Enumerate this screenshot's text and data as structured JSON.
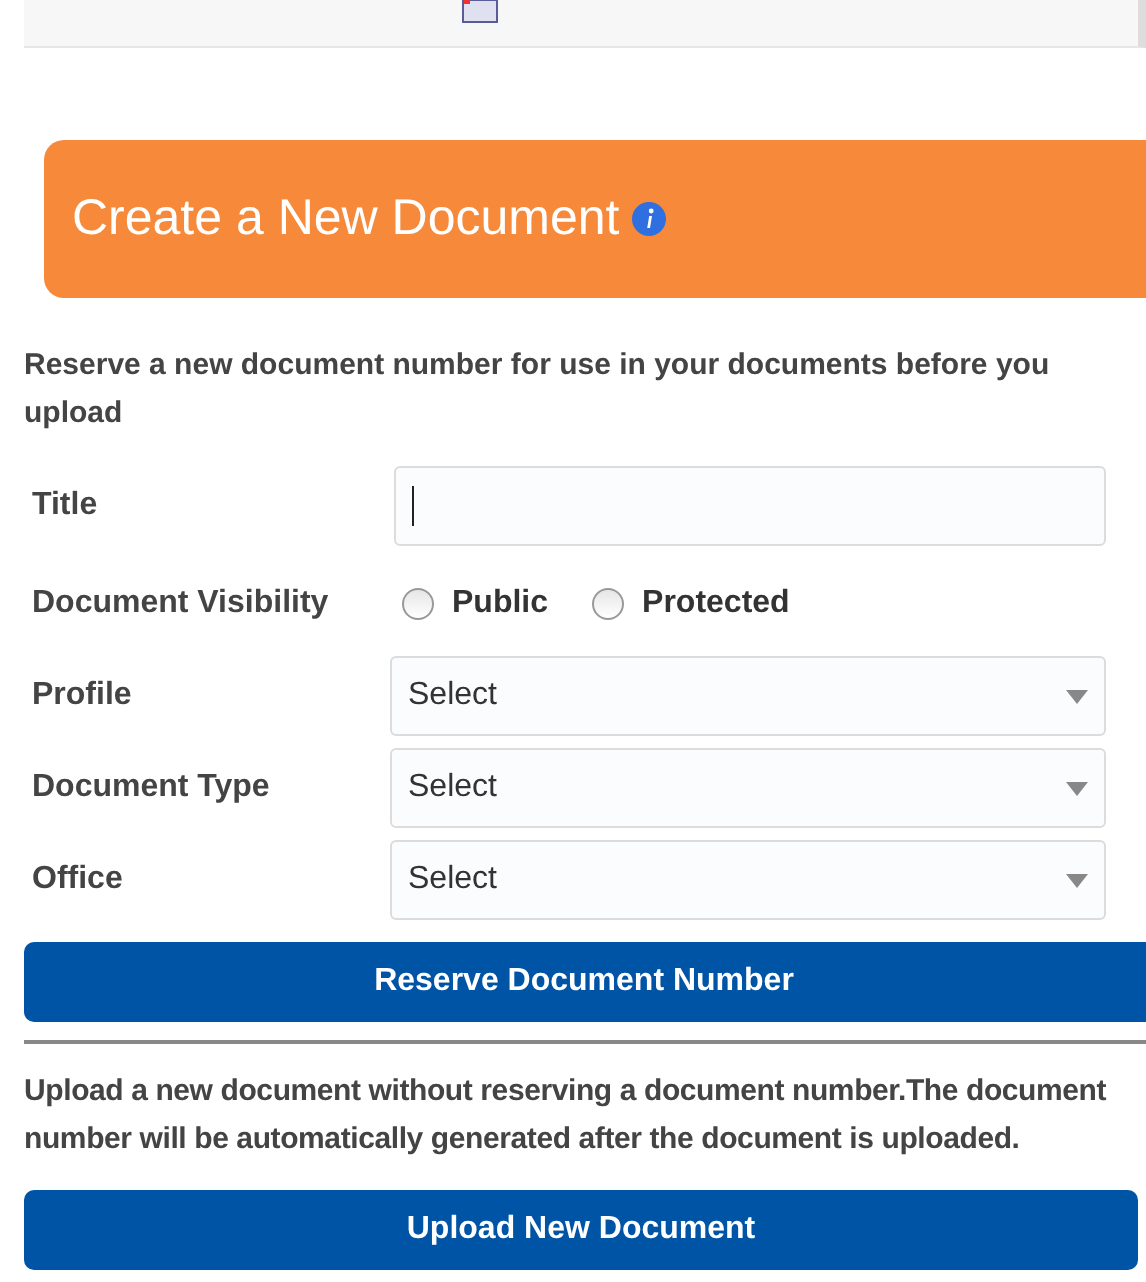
{
  "header": {
    "title": "Create a New Document"
  },
  "reserve": {
    "description": "Reserve a new document number for use in your documents before you upload",
    "fields": [
      {
        "kind": "text",
        "label": "Title"
      },
      {
        "kind": "radio",
        "label": "Document Visibility",
        "options": [
          {
            "label": "Public",
            "selected": false
          },
          {
            "label": "Protected",
            "selected": false
          }
        ]
      },
      {
        "kind": "select",
        "label": "Profile",
        "value": "Select"
      },
      {
        "kind": "select",
        "label": "Document Type",
        "value": "Select"
      },
      {
        "kind": "select",
        "label": "Office",
        "value": "Select"
      }
    ],
    "button": "Reserve Document Number"
  },
  "upload": {
    "description": "Upload a new document without reserving a document number.The document number will be automatically generated after the document is uploaded.",
    "button": "Upload New Document"
  }
}
